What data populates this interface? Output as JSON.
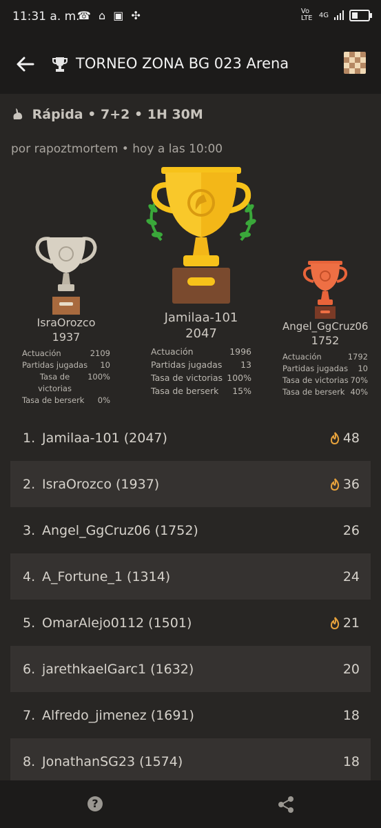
{
  "status_bar": {
    "time": "11:31 a. m.",
    "icons": "☎ ⌂ ▣ ✣",
    "network": "Vo LTE",
    "signal": "4G"
  },
  "app_bar": {
    "title": "TORNEO ZONA BG 023 Arena",
    "back_icon": "arrow-left-icon",
    "trophy_icon": "trophy-icon",
    "board_icon": "chessboard-icon"
  },
  "header": {
    "subtitle": "Rápida • 7+2 • 1H 30M",
    "subtitle_icon": "rabbit-icon",
    "byline": "por rapoztmortem • hoy a las 10:00"
  },
  "podium": {
    "first": {
      "name": "Jamilaa-101",
      "rating": "2047",
      "stats": [
        {
          "label": "Actuación",
          "value": "1996"
        },
        {
          "label": "Partidas jugadas",
          "value": "13"
        },
        {
          "label": "Tasa de victorias",
          "value": "100%"
        },
        {
          "label": "Tasa de berserk",
          "value": "15%"
        }
      ]
    },
    "second": {
      "name": "IsraOrozco",
      "rating": "1937",
      "stats": [
        {
          "label": "Actuación",
          "value": "2109"
        },
        {
          "label": "Partidas jugadas",
          "value": "10"
        },
        {
          "label": "Tasa de victorias",
          "value": "100%"
        },
        {
          "label": "Tasa de berserk",
          "value": "0%"
        }
      ]
    },
    "third": {
      "name": "Angel_GgCruz06",
      "rating": "1752",
      "stats": [
        {
          "label": "Actuación",
          "value": "1792"
        },
        {
          "label": "Partidas jugadas",
          "value": "10"
        },
        {
          "label": "Tasa de victorias",
          "value": "70%"
        },
        {
          "label": "Tasa de berserk",
          "value": "40%"
        }
      ]
    }
  },
  "standings": [
    {
      "pos": "1.",
      "player": "Jamilaa-101 (2047)",
      "score": "48",
      "fire": true
    },
    {
      "pos": "2.",
      "player": "IsraOrozco (1937)",
      "score": "36",
      "fire": true
    },
    {
      "pos": "3.",
      "player": "Angel_GgCruz06 (1752)",
      "score": "26",
      "fire": false
    },
    {
      "pos": "4.",
      "player": "A_Fortune_1 (1314)",
      "score": "24",
      "fire": false
    },
    {
      "pos": "5.",
      "player": "OmarAlejo0112 (1501)",
      "score": "21",
      "fire": true
    },
    {
      "pos": "6.",
      "player": "jarethkaelGarc1 (1632)",
      "score": "20",
      "fire": false
    },
    {
      "pos": "7.",
      "player": "Alfredo_jimenez (1691)",
      "score": "18",
      "fire": false
    },
    {
      "pos": "8.",
      "player": "JonathanSG23 (1574)",
      "score": "18",
      "fire": false
    }
  ],
  "bottom_bar": {
    "help_icon": "help-icon",
    "share_icon": "share-icon",
    "help_glyph": "?"
  },
  "colors": {
    "background": "#282624",
    "bar": "#1c1b1a",
    "alt_row": "#353230",
    "gold": "#f5c518",
    "silver": "#c9c2b3",
    "bronze": "#e8643a",
    "flame": "#e8a33c"
  }
}
